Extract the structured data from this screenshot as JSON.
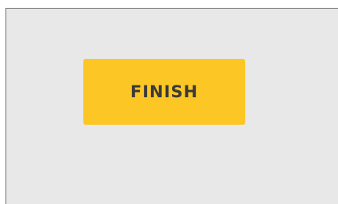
{
  "panel": {
    "background": "#e8e8e8",
    "border_color": "#6f6f6f"
  },
  "finish_button": {
    "label": "FINISH",
    "background": "#fcc725",
    "text_color": "#3a3a3a"
  }
}
